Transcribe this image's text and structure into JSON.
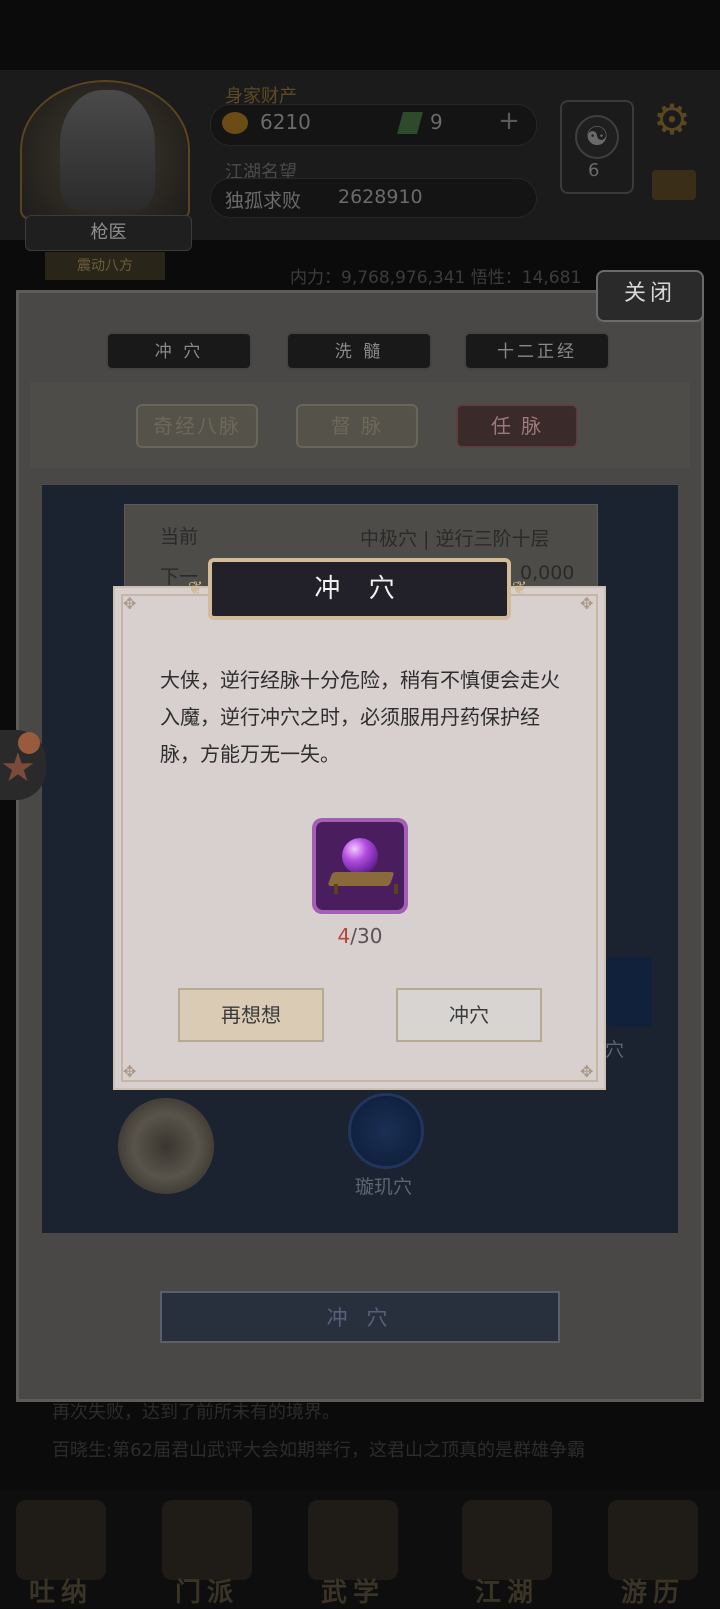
{
  "header": {
    "player_title": "枪医",
    "player_subtitle": "震动八方",
    "wealth_label": "身家财产",
    "gold": "6210",
    "gems": "9",
    "plus_label": "+",
    "fame_label": "江湖名望",
    "fame_title": "独孤求败",
    "fame_value": "2628910",
    "taiji_count": "6",
    "stats_line": "内力：9,768,976,341   悟性：14,681"
  },
  "panel": {
    "close_label": "关闭",
    "top_tabs": [
      "冲 穴",
      "洗 髓",
      "十二正经"
    ],
    "sub_tabs": [
      "奇经八脉",
      "督 脉",
      "任 脉"
    ],
    "active_sub_tab": "任 脉",
    "info": {
      "current_label": "当前",
      "current_value": "中极穴 | 逆行三阶十层",
      "next_label": "下一",
      "next_value": "0,000"
    },
    "node_label_partial": "穴",
    "node_label": "璇玑穴",
    "bottom_button": "冲 穴"
  },
  "news": {
    "line1": "再次失败，达到了前所未有的境界。",
    "line2": "百晓生:第62届君山武评大会如期举行，这君山之顶真的是群雄争霸"
  },
  "nav": {
    "items": [
      "吐纳",
      "门派",
      "武学",
      "江湖",
      "游历"
    ]
  },
  "modal": {
    "title": "冲 穴",
    "message": "大侠，逆行经脉十分危险，稍有不慎便会走火入魔，逆行冲穴之时，必须服用丹药保护经脉，方能万无一失。",
    "item_have": "4",
    "item_need": "/30",
    "cancel_label": "再想想",
    "confirm_label": "冲穴"
  },
  "colors": {
    "modal_bg": "#d8cfcf",
    "title_bg": "#22212a",
    "title_border": "#d2bb98",
    "item_frame": "#a45fb5",
    "count_have": "#b5463e"
  }
}
